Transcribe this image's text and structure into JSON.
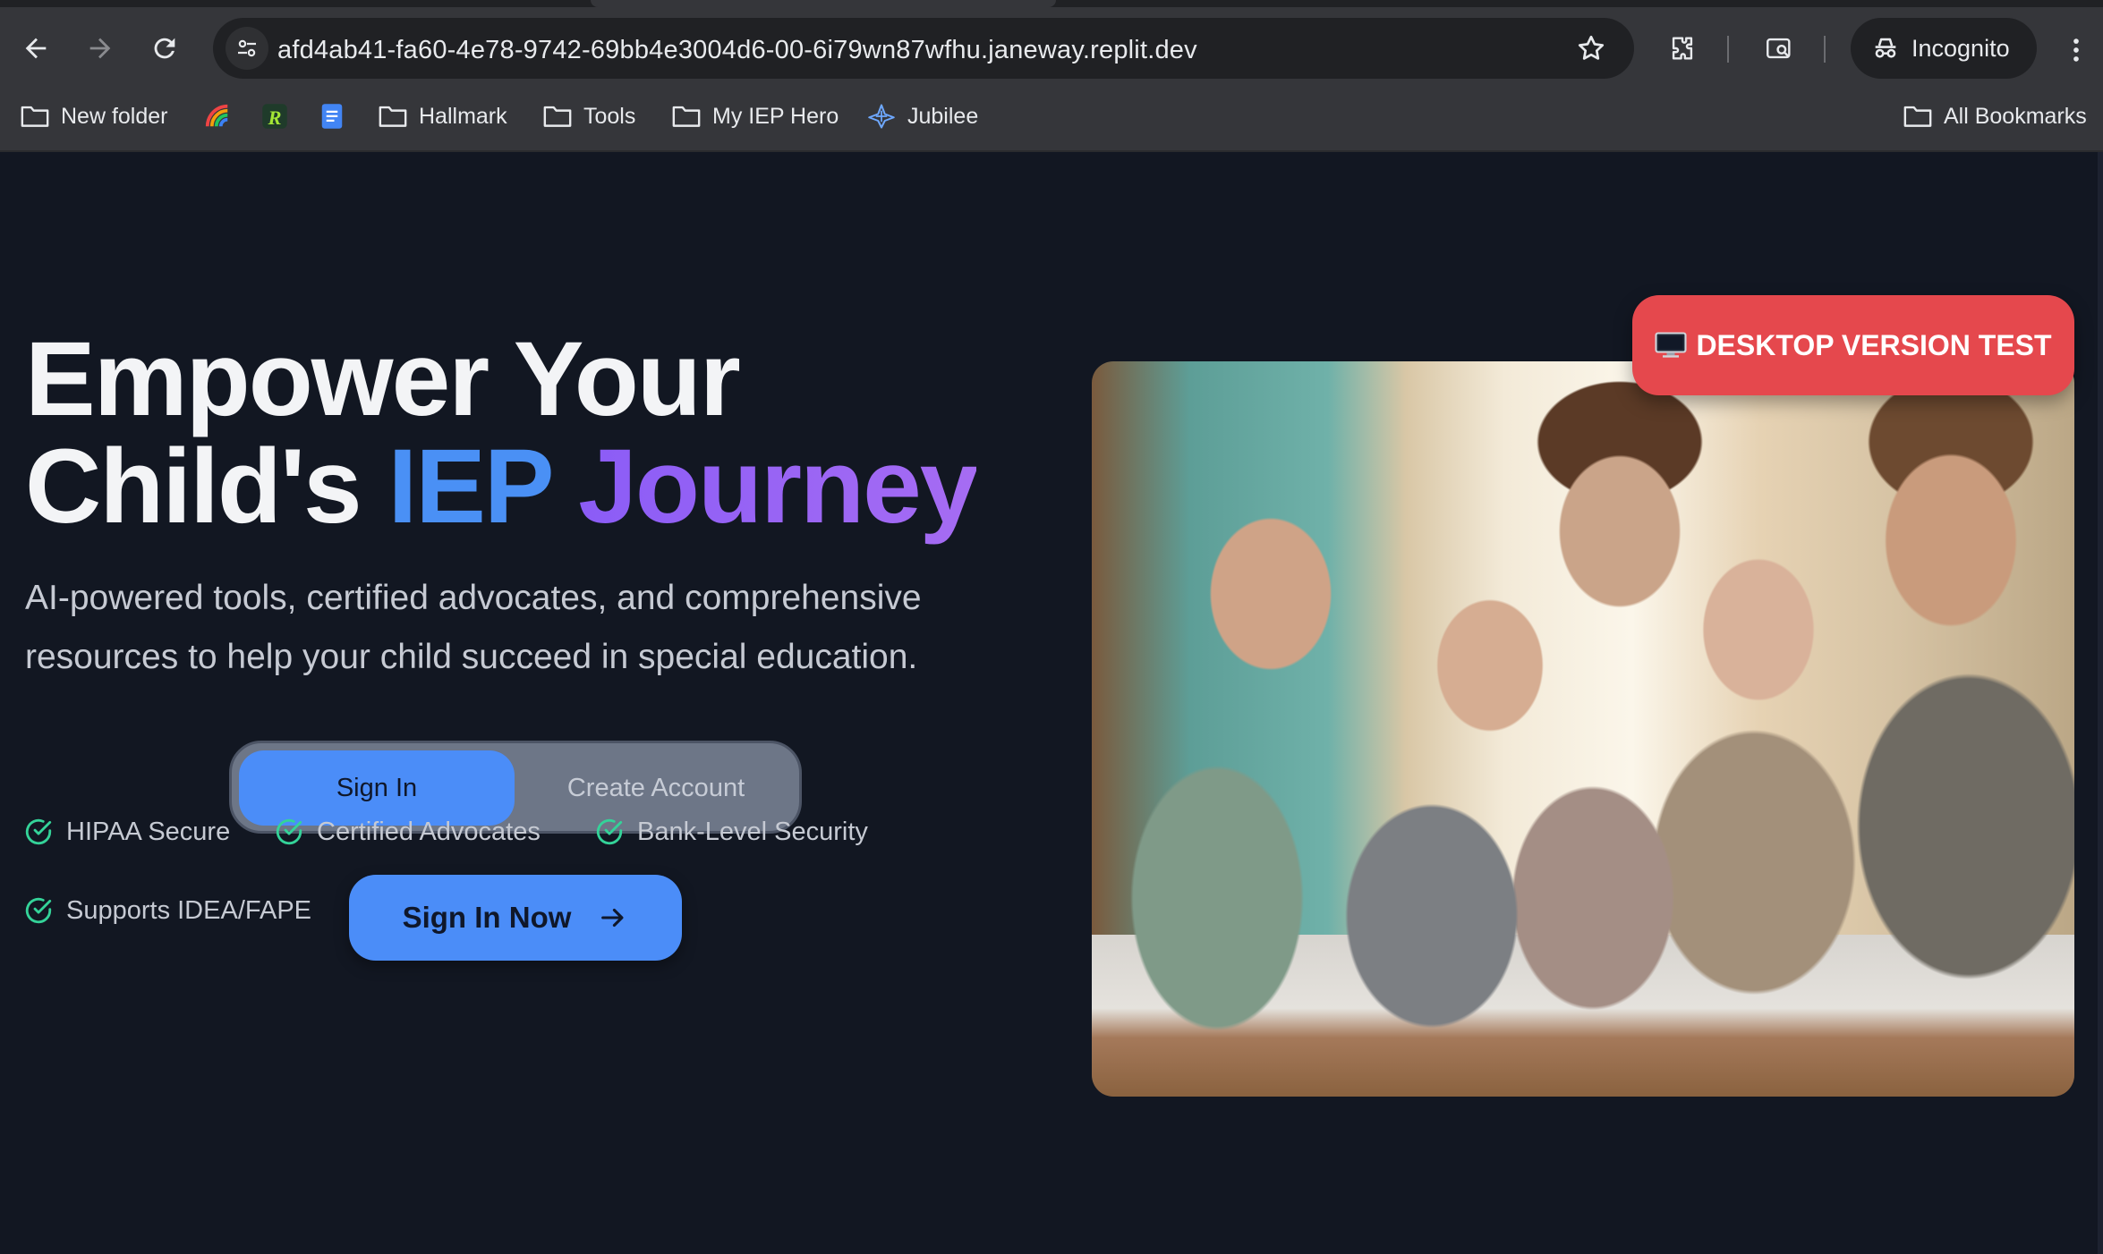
{
  "browser": {
    "url": "afd4ab41-fa60-4e78-9742-69bb4e3004d6-00-6i79wn87wfhu.janeway.replit.dev",
    "profile_label": "Incognito",
    "icons": {
      "back": "arrow-left-icon",
      "forward": "arrow-right-icon",
      "reload": "reload-icon",
      "site_info": "tune-icon",
      "bookmark_star": "star-icon",
      "extensions": "puzzle-icon",
      "search_tabs": "tab-search-icon",
      "profile": "incognito-icon",
      "menu": "more-vertical-icon"
    }
  },
  "bookmarks": {
    "items": [
      {
        "label": "New folder",
        "icon": "folder-icon"
      },
      {
        "label": "",
        "icon": "rainbow-app-icon"
      },
      {
        "label": "",
        "icon": "r-app-icon"
      },
      {
        "label": "",
        "icon": "docs-icon"
      },
      {
        "label": "Hallmark",
        "icon": "folder-icon"
      },
      {
        "label": "Tools",
        "icon": "folder-icon"
      },
      {
        "label": "My IEP Hero",
        "icon": "folder-icon"
      },
      {
        "label": "Jubilee",
        "icon": "jubilee-icon"
      }
    ],
    "all_bookmarks": "All Bookmarks"
  },
  "hero": {
    "title_line1": "Empower Your",
    "title_line2_prefix": "Child's",
    "title_highlight_1": "IEP",
    "title_highlight_2": "Journey",
    "subtitle": "AI-powered tools, certified advocates, and comprehensive resources to help your child succeed in special education."
  },
  "auth": {
    "tabs": [
      {
        "label": "Sign In",
        "active": true
      },
      {
        "label": "Create Account",
        "active": false
      }
    ],
    "cta_label": "Sign In Now",
    "cta_icon": "arrow-right-icon"
  },
  "features": [
    {
      "label": "HIPAA Secure",
      "icon": "check-circle-icon"
    },
    {
      "label": "Certified Advocates",
      "icon": "check-circle-icon"
    },
    {
      "label": "Bank-Level Security",
      "icon": "check-circle-icon"
    },
    {
      "label": "Supports IDEA/FAPE",
      "icon": "check-circle-icon"
    }
  ],
  "badge": {
    "label": "DESKTOP VERSION TEST",
    "icon": "desktop-monitor-icon"
  },
  "colors": {
    "page_bg": "#121722",
    "accent_blue": "#4b8df8",
    "accent_purple": "#8b5cf6",
    "badge_red": "#e5484d",
    "check_green": "#34d399"
  }
}
